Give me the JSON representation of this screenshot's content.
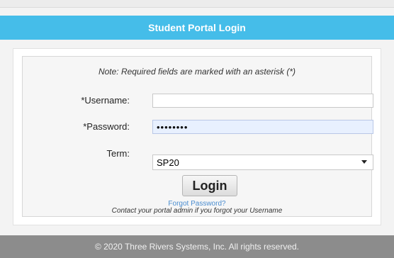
{
  "header": {
    "title": "Student Portal Login"
  },
  "form": {
    "note": "Note: Required fields are marked with an asterisk (*)",
    "username": {
      "label": "*Username:",
      "value": ""
    },
    "password": {
      "label": "*Password:",
      "value": "••••••••"
    },
    "term": {
      "label": "Term:",
      "selected": "SP20"
    },
    "login_label": "Login",
    "forgot_password": "Forgot Password?",
    "contact_note": "Contact your portal admin if you forgot your Username"
  },
  "footer": {
    "text": "© 2020 Three Rivers Systems, Inc. All rights reserved."
  }
}
